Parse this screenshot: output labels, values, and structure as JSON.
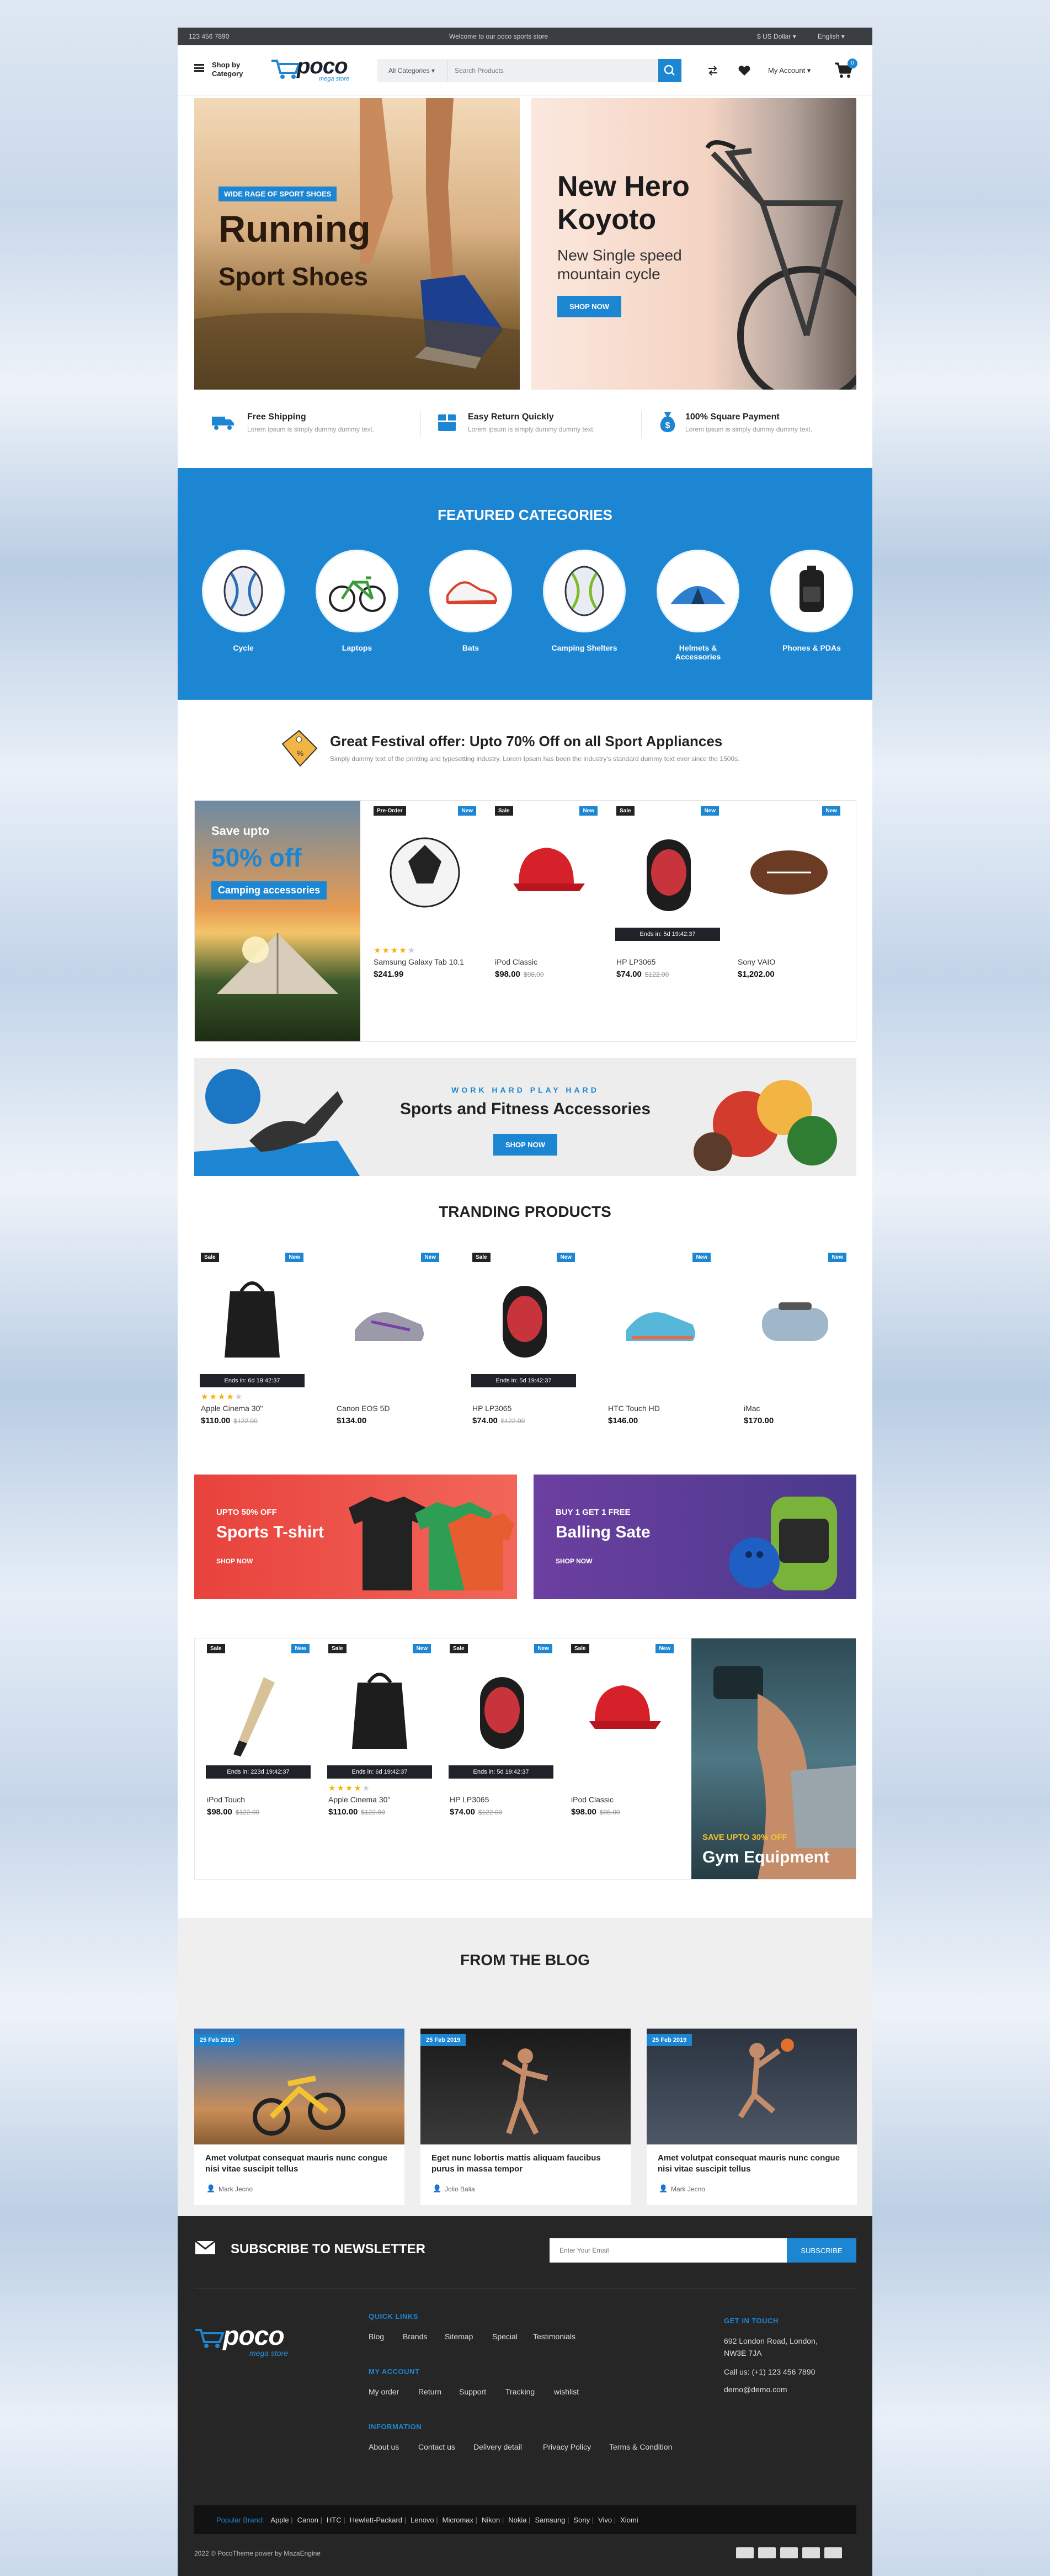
{
  "topbar": {
    "phone": "123 456 7890",
    "welcome": "Welcome to our poco sports store",
    "currency": "$ US Dollar ▾",
    "language": "English ▾"
  },
  "header": {
    "menu_label_1": "Shop by",
    "menu_label_2": "Category",
    "logo": "poco",
    "logo_sub": "mega store",
    "search_category": "All Categories",
    "search_placeholder": "Search Products",
    "account": "My Account ▾",
    "cart_count": "0"
  },
  "hero": {
    "left": {
      "badge": "WIDE RAGE OF SPORT SHOES",
      "title_1": "Running",
      "title_2": "Sport Shoes"
    },
    "right": {
      "title_1": "New Hero",
      "title_2": "Koyoto",
      "sub_1": "New Single speed",
      "sub_2": "mountain cycle",
      "button": "SHOP NOW"
    }
  },
  "features": [
    {
      "title": "Free Shipping",
      "sub": "Lorem ipsum is simply dummy dummy text.",
      "icon": "truck-icon"
    },
    {
      "title": "Easy Return Quickly",
      "sub": "Lorem ipsum is simply dummy dummy text.",
      "icon": "box-icon"
    },
    {
      "title": "100% Square Payment",
      "sub": "Lorem ipsum is simply dummy dummy text.",
      "icon": "money-bag-icon"
    }
  ],
  "categories": {
    "title": "FEATURED CATEGORIES",
    "items": [
      "Cycle",
      "Laptops",
      "Bats",
      "Camping Shelters",
      "Helmets & Accessories",
      "Phones & PDAs"
    ]
  },
  "offer": {
    "title": "Great Festival offer: Upto 70% Off on all Sport Appliances",
    "sub": "Simply dummy text of the printing and typesetting industry. Lorem Ipsum has been the industry's standard dummy text ever since the 1500s."
  },
  "deal": {
    "save": "Save upto",
    "percent": "50% off",
    "label": "Camping accessories",
    "products": [
      {
        "tag": "Pre-Order",
        "new": "New",
        "name": "Samsung Galaxy Tab 10.1",
        "price": "$241.99",
        "old": "",
        "rating": 4,
        "ends": ""
      },
      {
        "tag": "Sale",
        "new": "New",
        "name": "iPod Classic",
        "price": "$98.00",
        "old": "$98.00",
        "rating": 0,
        "ends": ""
      },
      {
        "tag": "Sale",
        "new": "New",
        "name": "HP LP3065",
        "price": "$74.00",
        "old": "$122.00",
        "rating": 0,
        "ends": "Ends in: 5d 19:42:37"
      },
      {
        "tag": "",
        "new": "New",
        "name": "Sony VAIO",
        "price": "$1,202.00",
        "old": "",
        "rating": 0,
        "ends": ""
      }
    ]
  },
  "fitness": {
    "kicker": "WORK HARD PLAY HARD",
    "title": "Sports and Fitness Accessories",
    "button": "SHOP NOW"
  },
  "trending": {
    "title": "TRANDING PRODUCTS",
    "products": [
      {
        "tag": "Sale",
        "new": "New",
        "name": "Apple Cinema 30\"",
        "price": "$110.00",
        "old": "$122.00",
        "rating": 4,
        "ends": "Ends in: 6d 19:42:37"
      },
      {
        "tag": "",
        "new": "New",
        "name": "Canon EOS 5D",
        "price": "$134.00",
        "old": "",
        "rating": 0,
        "ends": ""
      },
      {
        "tag": "Sale",
        "new": "New",
        "name": "HP LP3065",
        "price": "$74.00",
        "old": "$122.00",
        "rating": 0,
        "ends": "Ends in: 5d 19:42:37"
      },
      {
        "tag": "",
        "new": "New",
        "name": "HTC Touch HD",
        "price": "$146.00",
        "old": "",
        "rating": 0,
        "ends": ""
      },
      {
        "tag": "",
        "new": "New",
        "name": "iMac",
        "price": "$170.00",
        "old": "",
        "rating": 0,
        "ends": ""
      }
    ]
  },
  "promo": {
    "left": {
      "kicker": "UPTO 50% OFF",
      "title": "Sports T-shirt",
      "link": "SHOP NOW"
    },
    "right": {
      "kicker": "BUY 1 GET 1 FREE",
      "title": "Balling Sate",
      "link": "SHOP NOW"
    }
  },
  "gym": {
    "save": "SAVE UPTO 30% OFF",
    "title": "Gym Equipment",
    "products": [
      {
        "tag": "Sale",
        "new": "New",
        "name": "iPod Touch",
        "price": "$98.00",
        "old": "$122.00",
        "rating": 0,
        "ends": "Ends in: 223d 19:42:37"
      },
      {
        "tag": "Sale",
        "new": "New",
        "name": "Apple Cinema 30\"",
        "price": "$110.00",
        "old": "$122.00",
        "rating": 4,
        "ends": "Ends in: 6d 19:42:37"
      },
      {
        "tag": "Sale",
        "new": "New",
        "name": "HP LP3065",
        "price": "$74.00",
        "old": "$122.00",
        "rating": 0,
        "ends": "Ends in: 5d 19:42:37"
      },
      {
        "tag": "Sale",
        "new": "New",
        "name": "iPod Classic",
        "price": "$98.00",
        "old": "$98.00",
        "rating": 0,
        "ends": ""
      }
    ]
  },
  "blog": {
    "title": "FROM THE BLOG",
    "posts": [
      {
        "date": "25 Feb 2019",
        "title": "Amet volutpat consequat mauris nunc congue nisi vitae suscipit tellus",
        "author": "Mark Jecno"
      },
      {
        "date": "25 Feb 2019",
        "title": "Eget nunc lobortis mattis aliquam faucibus purus in massa tempor",
        "author": "Jolio Balia"
      },
      {
        "date": "25 Feb 2019",
        "title": "Amet volutpat consequat mauris nunc congue nisi vitae suscipit tellus",
        "author": "Mark Jecno"
      }
    ]
  },
  "newsletter": {
    "title": "SUBSCRIBE TO NEWSLETTER",
    "placeholder": "Enter Your Email",
    "button": "SUBSCRIBE"
  },
  "footer": {
    "logo": "poco",
    "logo_sub": "mega store",
    "quick_links": {
      "title": "QUICK LINKS",
      "items": [
        "Blog",
        "Brands",
        "Sitemap",
        "Special",
        "Testimonials"
      ]
    },
    "my_account": {
      "title": "MY ACCOUNT",
      "items": [
        "My order",
        "Return",
        "Support",
        "Tracking",
        "wishlist"
      ]
    },
    "information": {
      "title": "INFORMATION",
      "items": [
        "About us",
        "Contact us",
        "Delivery detail",
        "Privacy Policy",
        "Terms & Condition"
      ]
    },
    "get_in_touch": {
      "title": "GET IN TOUCH",
      "address_1": "692 London Road, London,",
      "address_2": "NW3E 7JA",
      "phone": "Call us: (+1) 123 456 7890",
      "email": "demo@demo.com"
    },
    "brands_label": "Popular Brand:",
    "brands": [
      "Apple",
      "Canon",
      "HTC",
      "Hewlett-Packard",
      "Lenovo",
      "Micromax",
      "Nikon",
      "Nokia",
      "Samsung",
      "Sony",
      "Vivo",
      "Xiomi"
    ],
    "copyright": "2022 © PocoTheme power by MazaEngine",
    "payment_icons": [
      "card-icon",
      "mastercard-icon",
      "visa-icon",
      "paypal-icon",
      "amex-icon"
    ]
  },
  "colors": {
    "accent": "#1d86d2",
    "dark": "#262626",
    "topbar": "#3a3d42"
  }
}
